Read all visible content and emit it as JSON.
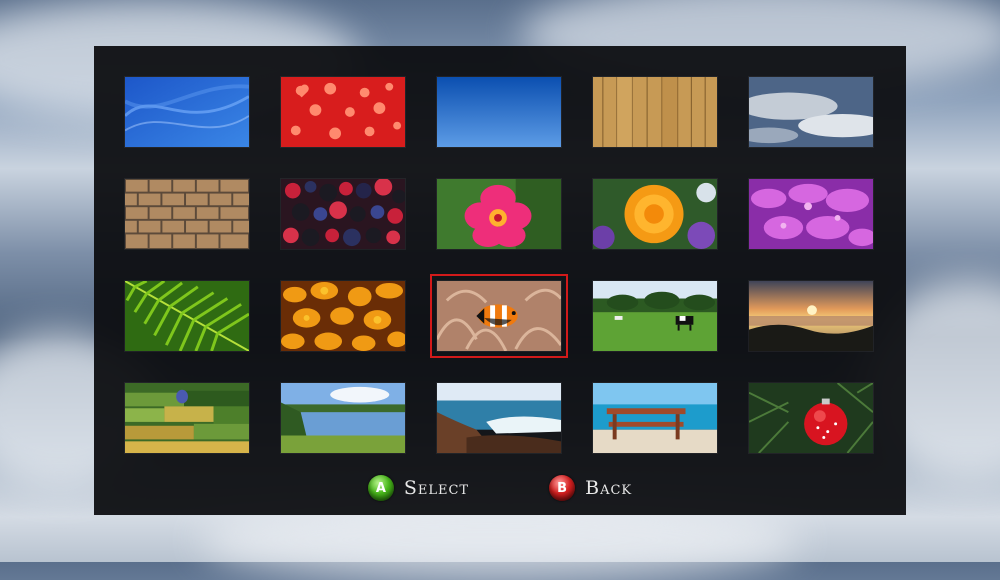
{
  "footer": {
    "select": {
      "button_glyph": "A",
      "label": "Select",
      "color": "#3db515",
      "icon": "a-button-icon"
    },
    "back": {
      "button_glyph": "B",
      "label": "Back",
      "color": "#d02020",
      "icon": "b-button-icon"
    }
  },
  "wallpapers": [
    {
      "name": "blue-waves",
      "selected": false
    },
    {
      "name": "red-hearts",
      "selected": false
    },
    {
      "name": "blue-gradient",
      "selected": false
    },
    {
      "name": "wood-planks",
      "selected": false
    },
    {
      "name": "sky-clouds",
      "selected": false
    },
    {
      "name": "brick-wall",
      "selected": false
    },
    {
      "name": "berries",
      "selected": false
    },
    {
      "name": "hibiscus",
      "selected": false
    },
    {
      "name": "orange-rose",
      "selected": false
    },
    {
      "name": "purple-flowers",
      "selected": false
    },
    {
      "name": "fern",
      "selected": false
    },
    {
      "name": "autumn-leaves",
      "selected": false
    },
    {
      "name": "clownfish",
      "selected": true
    },
    {
      "name": "cows-field",
      "selected": false
    },
    {
      "name": "sunset-sea",
      "selected": false
    },
    {
      "name": "hot-air-balloon",
      "selected": false
    },
    {
      "name": "lake",
      "selected": false
    },
    {
      "name": "rocky-coast",
      "selected": false
    },
    {
      "name": "beach-bench",
      "selected": false
    },
    {
      "name": "christmas-ornament",
      "selected": false
    }
  ]
}
